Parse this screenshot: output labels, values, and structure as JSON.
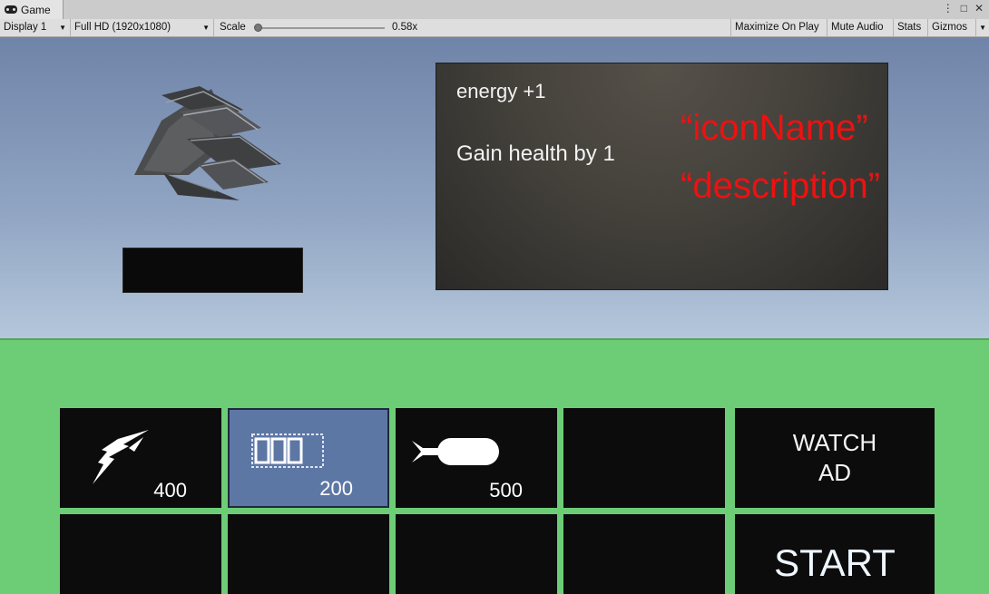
{
  "editor": {
    "tab_title": "Game",
    "display": "Display 1",
    "resolution": "Full HD (1920x1080)",
    "scale_label": "Scale",
    "scale_value": "0.58x",
    "scale_fraction": 0.0,
    "maximize": "Maximize On Play",
    "mute": "Mute Audio",
    "stats": "Stats",
    "gizmos": "Gizmos",
    "menu_glyph": "⋮",
    "maximize_glyph": "□",
    "close_glyph": "✕"
  },
  "info": {
    "icon_name": "energy +1",
    "description": "Gain health by 1",
    "annotation_name": "“iconName”",
    "annotation_description": "“description”"
  },
  "shop": {
    "items": [
      {
        "icon": "flame-bolt-icon",
        "price": "400"
      },
      {
        "icon": "battery-icon",
        "price": "200",
        "selected": true
      },
      {
        "icon": "bomb-icon",
        "price": "500"
      }
    ],
    "watch_ad": "WATCH AD",
    "start": "START"
  },
  "colors": {
    "panel": "#6ccd76",
    "selected_slot": "#5d77a5",
    "annotation": "#ee1111"
  }
}
